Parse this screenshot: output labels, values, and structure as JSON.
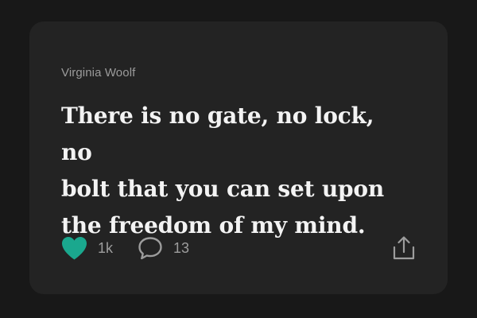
{
  "post": {
    "author": "Virginia Woolf",
    "quote_lines": [
      "There is no gate, no lock, no",
      "bolt that you can set upon",
      "the freedom of my mind."
    ]
  },
  "actions": {
    "like": {
      "icon": "heart-icon",
      "count": "1k",
      "color": "#1aa88e",
      "liked": true
    },
    "comment": {
      "icon": "speech-bubble-icon",
      "count": "13"
    },
    "share": {
      "icon": "share-icon"
    }
  },
  "colors": {
    "page_background": "#181818",
    "card_background": "#232323",
    "accent": "#1aa88e",
    "author_text": "#9b9b9b",
    "quote_text": "#f3f3f3",
    "count_text": "#9d9d9d"
  }
}
